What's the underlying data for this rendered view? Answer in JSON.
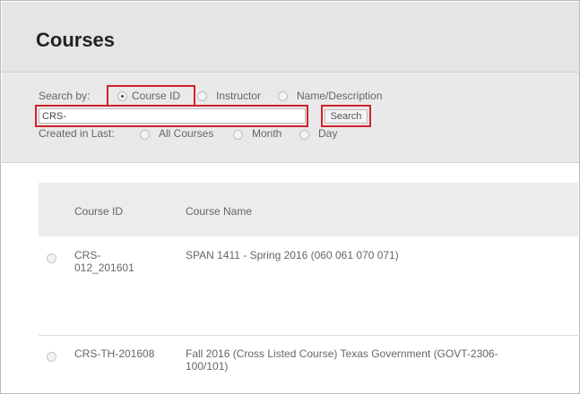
{
  "page": {
    "title": "Courses"
  },
  "search": {
    "label": "Search by:",
    "options": [
      "Course ID",
      "Instructor",
      "Name/Description"
    ],
    "selected": "Course ID",
    "query": "CRS-",
    "button_label": "Search",
    "created_label": "Created in Last:",
    "created_options": [
      "All Courses",
      "Month",
      "Day"
    ]
  },
  "table": {
    "columns": [
      "Course ID",
      "Course Name"
    ],
    "rows": [
      {
        "id_line1": "CRS-",
        "id_line2": "012_201601",
        "name_line1": "SPAN 1411 - Spring 2016 (060 061 070 071)",
        "name_line2": ""
      },
      {
        "id_line1": "CRS-TH-201608",
        "id_line2": "",
        "name_line1": "Fall 2016 (Cross Listed Course) Texas Government (GOVT-2306-",
        "name_line2": "100/101)"
      }
    ]
  },
  "colors": {
    "highlight": "#d2222a",
    "header_bg": "#e5e5e5",
    "panel_bg": "#e9e9e9"
  }
}
